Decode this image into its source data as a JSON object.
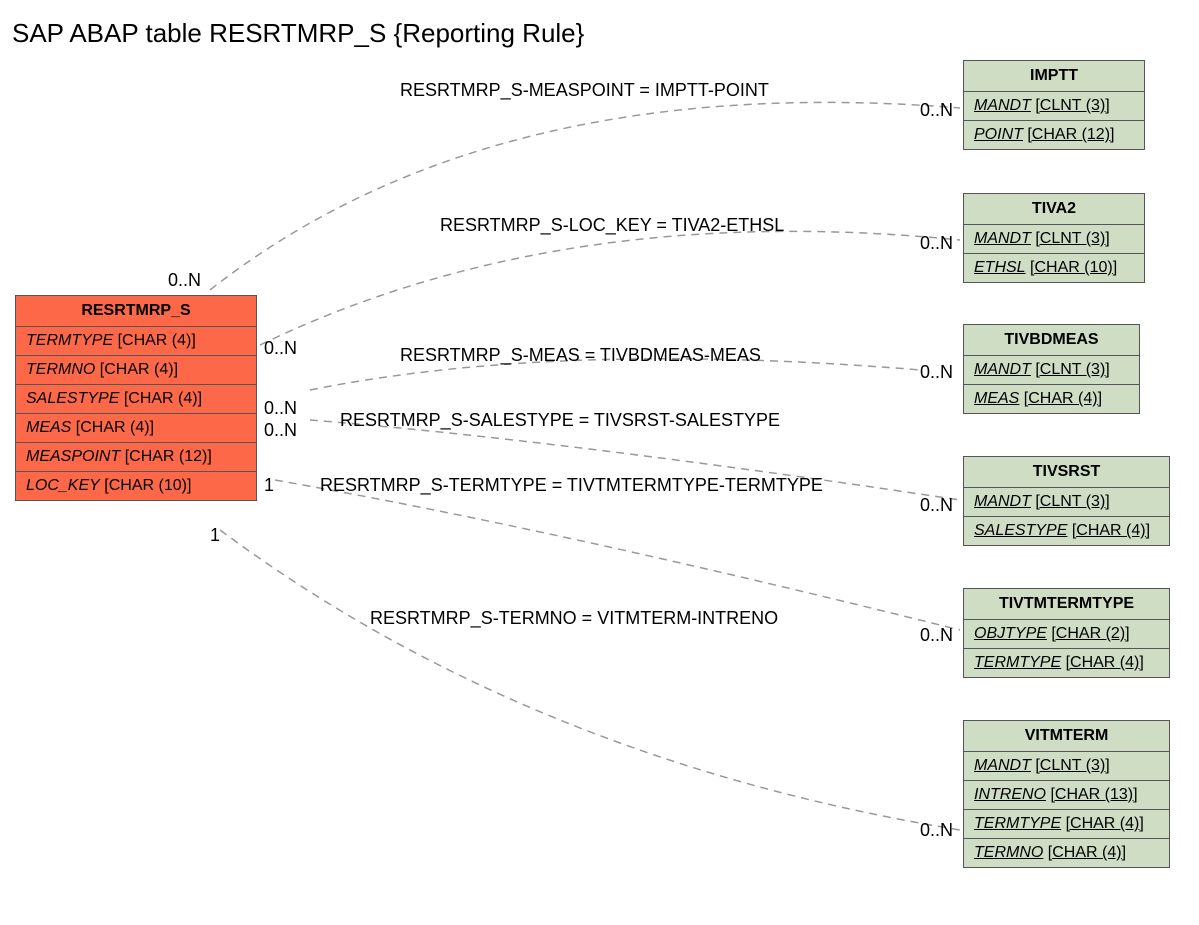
{
  "title": "SAP ABAP table RESRTMRP_S {Reporting Rule}",
  "main": {
    "name": "RESRTMRP_S",
    "fields": [
      {
        "name": "TERMTYPE",
        "type": "[CHAR (4)]"
      },
      {
        "name": "TERMNO",
        "type": "[CHAR (4)]"
      },
      {
        "name": "SALESTYPE",
        "type": "[CHAR (4)]"
      },
      {
        "name": "MEAS",
        "type": "[CHAR (4)]"
      },
      {
        "name": "MEASPOINT",
        "type": "[CHAR (12)]"
      },
      {
        "name": "LOC_KEY",
        "type": "[CHAR (10)]"
      }
    ]
  },
  "related": [
    {
      "name": "IMPTT",
      "fields": [
        {
          "name": "MANDT",
          "type": "[CLNT (3)]",
          "underline": true,
          "italicType": true
        },
        {
          "name": "POINT",
          "type": "[CHAR (12)]",
          "underline": true
        }
      ]
    },
    {
      "name": "TIVA2",
      "fields": [
        {
          "name": "MANDT",
          "type": "[CLNT (3)]",
          "underline": true,
          "italicType": true
        },
        {
          "name": "ETHSL",
          "type": "[CHAR (10)]",
          "underline": true
        }
      ]
    },
    {
      "name": "TIVBDMEAS",
      "fields": [
        {
          "name": "MANDT",
          "type": "[CLNT (3)]",
          "underline": true,
          "italicType": true
        },
        {
          "name": "MEAS",
          "type": "[CHAR (4)]",
          "underline": true
        }
      ]
    },
    {
      "name": "TIVSRST",
      "fields": [
        {
          "name": "MANDT",
          "type": "[CLNT (3)]",
          "underline": true
        },
        {
          "name": "SALESTYPE",
          "type": "[CHAR (4)]",
          "underline": true
        }
      ]
    },
    {
      "name": "TIVTMTERMTYPE",
      "fields": [
        {
          "name": "OBJTYPE",
          "type": "[CHAR (2)]",
          "underline": true
        },
        {
          "name": "TERMTYPE",
          "type": "[CHAR (4)]",
          "underline": true
        }
      ]
    },
    {
      "name": "VITMTERM",
      "fields": [
        {
          "name": "MANDT",
          "type": "[CLNT (3)]",
          "underline": true
        },
        {
          "name": "INTRENO",
          "type": "[CHAR (13)]",
          "underline": true
        },
        {
          "name": "TERMTYPE",
          "type": "[CHAR (4)]",
          "underline": true,
          "italicType": true
        },
        {
          "name": "TERMNO",
          "type": "[CHAR (4)]",
          "underline": true
        }
      ]
    }
  ],
  "relations": [
    {
      "label": "RESRTMRP_S-MEASPOINT = IMPTT-POINT"
    },
    {
      "label": "RESRTMRP_S-LOC_KEY = TIVA2-ETHSL"
    },
    {
      "label": "RESRTMRP_S-MEAS = TIVBDMEAS-MEAS"
    },
    {
      "label": "RESRTMRP_S-SALESTYPE = TIVSRST-SALESTYPE"
    },
    {
      "label": "RESRTMRP_S-TERMTYPE = TIVTMTERMTYPE-TERMTYPE"
    },
    {
      "label": "RESRTMRP_S-TERMNO = VITMTERM-INTRENO"
    }
  ],
  "cards": {
    "main": [
      "0..N",
      "0..N",
      "0..N",
      "0..N",
      "1",
      "1"
    ],
    "related": [
      "0..N",
      "0..N",
      "0..N",
      "0..N",
      "0..N",
      "0..N"
    ]
  }
}
